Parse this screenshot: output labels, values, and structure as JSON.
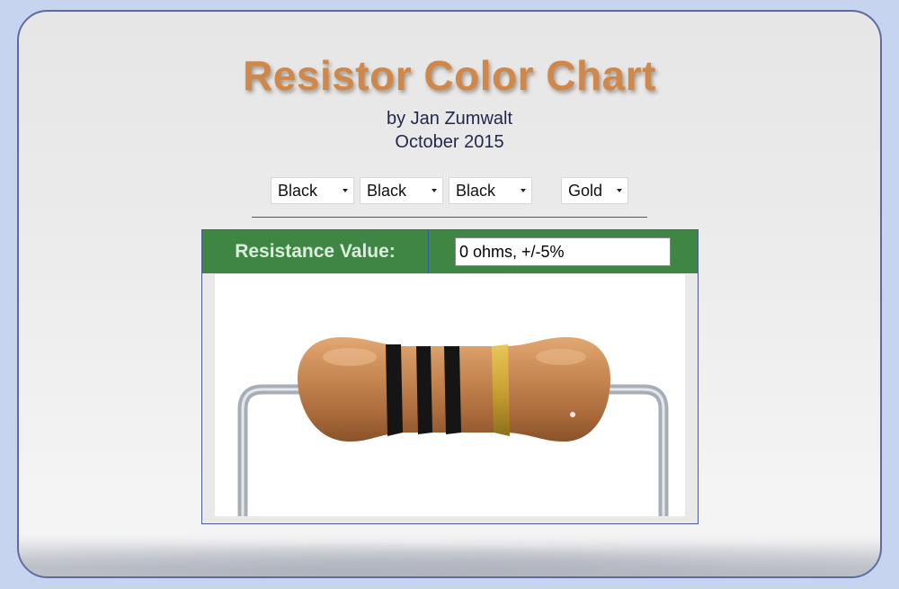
{
  "header": {
    "title": "Resistor Color Chart",
    "author": "by Jan Zumwalt",
    "date": "October 2015"
  },
  "bands": {
    "band1": "Black",
    "band2": "Black",
    "band3": "Black",
    "tolerance": "Gold"
  },
  "result": {
    "label": "Resistance Value:",
    "value": "0 ohms, +/-5%"
  },
  "colors": {
    "title": "#d0874a",
    "header_bar": "#3f8645",
    "band_black": "#151515",
    "band_gold": "#c9a233",
    "resistor_body": "#c98a55",
    "lead_wire": "#b7bcc4"
  }
}
